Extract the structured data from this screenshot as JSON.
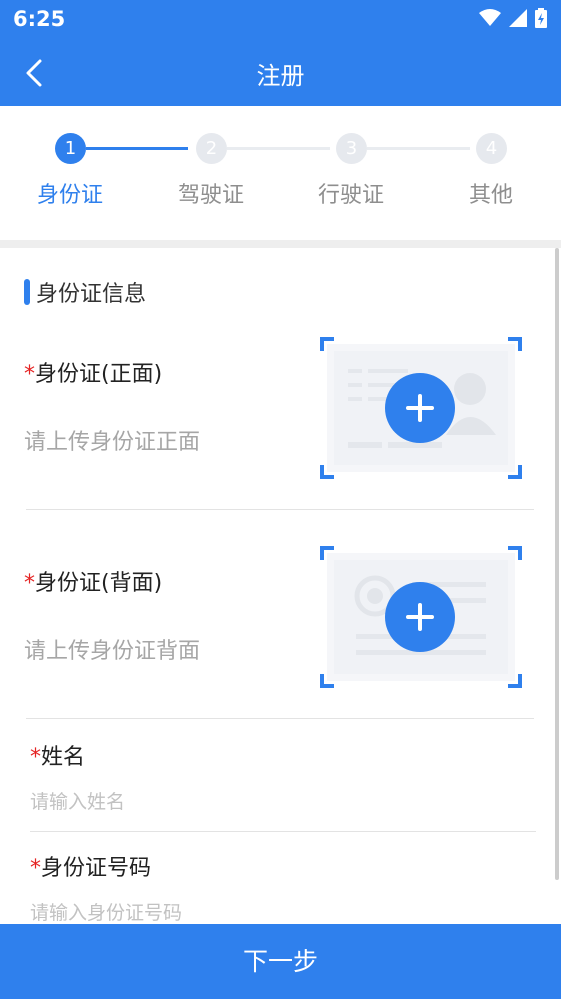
{
  "status_bar": {
    "time": "6:25"
  },
  "header": {
    "title": "注册"
  },
  "steps": [
    {
      "number": "1",
      "label": "身份证",
      "active": true
    },
    {
      "number": "2",
      "label": "驾驶证",
      "active": false
    },
    {
      "number": "3",
      "label": "行驶证",
      "active": false
    },
    {
      "number": "4",
      "label": "其他",
      "active": false
    }
  ],
  "section": {
    "title": "身份证信息"
  },
  "id_front": {
    "required_mark": "*",
    "label": "身份证(正面)",
    "hint": "请上传身份证正面"
  },
  "id_back": {
    "required_mark": "*",
    "label": "身份证(背面)",
    "hint": "请上传身份证背面"
  },
  "name_field": {
    "required_mark": "*",
    "label": "姓名",
    "placeholder": "请输入姓名",
    "value": ""
  },
  "id_number_field": {
    "required_mark": "*",
    "label": "身份证号码",
    "placeholder": "请输入身份证号码",
    "value": ""
  },
  "footer": {
    "next_label": "下一步"
  },
  "colors": {
    "primary": "#2f80ed",
    "required": "#e52424",
    "hint": "#a6a6a6",
    "step_inactive": "#e6e9ee"
  }
}
